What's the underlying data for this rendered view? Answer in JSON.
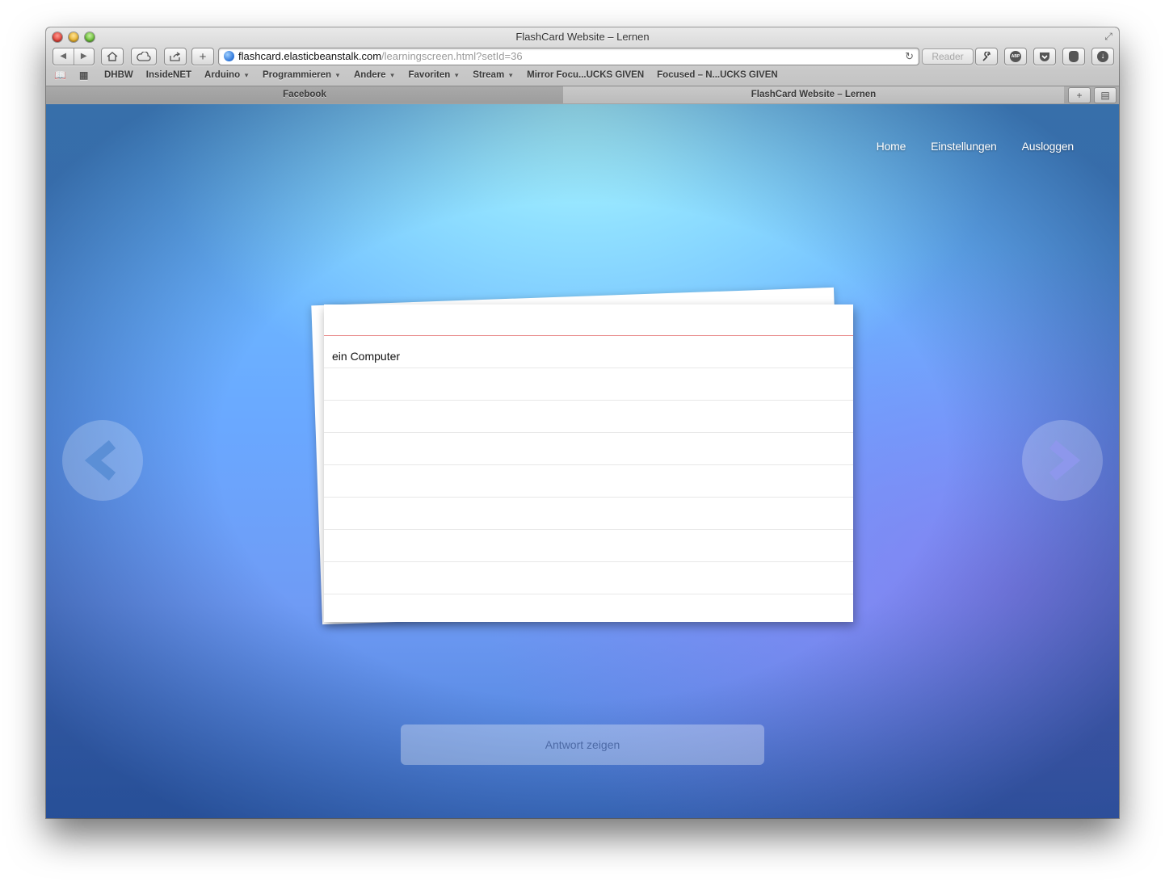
{
  "window": {
    "title": "FlashCard Website – Lernen"
  },
  "toolbar": {
    "url_host": "flashcard.elasticbeanstalk.com",
    "url_path": "/learningscreen.html?setId=36",
    "reader_label": "Reader"
  },
  "bookmarks": [
    {
      "label": "DHBW",
      "folder": false
    },
    {
      "label": "InsideNET",
      "folder": false
    },
    {
      "label": "Arduino",
      "folder": true
    },
    {
      "label": "Programmieren",
      "folder": true
    },
    {
      "label": "Andere",
      "folder": true
    },
    {
      "label": "Favoriten",
      "folder": true
    },
    {
      "label": "Stream",
      "folder": true
    },
    {
      "label": "Mirror Focu...UCKS GIVEN",
      "folder": false
    },
    {
      "label": "Focused – N...UCKS GIVEN",
      "folder": false
    }
  ],
  "tabs": [
    {
      "label": "Facebook",
      "active": false
    },
    {
      "label": "FlashCard Website – Lernen",
      "active": true
    }
  ],
  "nav": {
    "home": "Home",
    "settings": "Einstellungen",
    "logout": "Ausloggen"
  },
  "card": {
    "text": "ein Computer"
  },
  "answer_button": "Antwort zeigen",
  "colors": {
    "bg_top": "#b4ffff",
    "bg_mid": "#6aa8ff",
    "bg_corner": "#4a7fd6",
    "card_rule": "#e88a8a"
  }
}
